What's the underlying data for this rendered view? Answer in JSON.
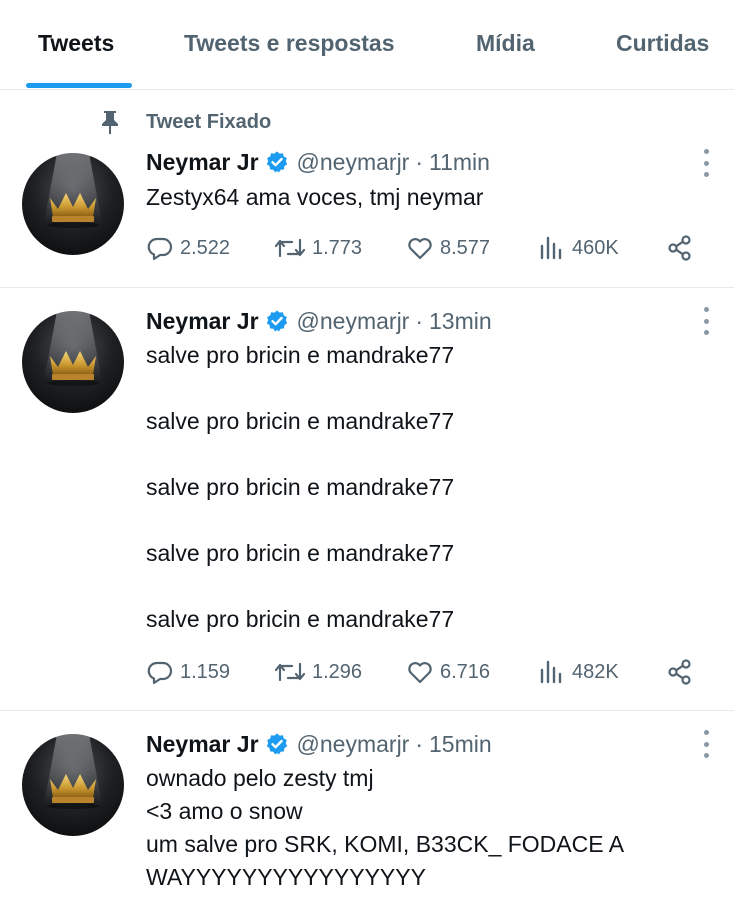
{
  "tabs": [
    {
      "label": "Tweets",
      "active": true
    },
    {
      "label": "Tweets e respostas",
      "active": false
    },
    {
      "label": "Mídia",
      "active": false
    },
    {
      "label": "Curtidas",
      "active": false
    }
  ],
  "accent_color": "#1d9bf0",
  "pinned_label": "Tweet Fixado",
  "tweets": [
    {
      "name": "Neymar Jr",
      "handle": "@neymarjr",
      "separator": "·",
      "time": "11min",
      "text": "Zestyx64 ama voces, tmj neymar",
      "replies": "2.522",
      "retweets": "1.773",
      "likes": "8.577",
      "views": "460K"
    },
    {
      "name": "Neymar Jr",
      "handle": "@neymarjr",
      "separator": "·",
      "time": "13min",
      "text": "salve pro bricin e mandrake77\n\nsalve pro bricin e mandrake77\n\nsalve pro bricin e mandrake77\n\nsalve pro bricin e mandrake77\n\nsalve pro bricin e mandrake77",
      "replies": "1.159",
      "retweets": "1.296",
      "likes": "6.716",
      "views": "482K"
    },
    {
      "name": "Neymar Jr",
      "handle": "@neymarjr",
      "separator": "·",
      "time": "15min",
      "text": "ownado pelo zesty tmj\n<3 amo o snow\num salve pro SRK, KOMI, B33CK_ FODACE A\nWAYYYYYYYYYYYYYYYY"
    }
  ]
}
